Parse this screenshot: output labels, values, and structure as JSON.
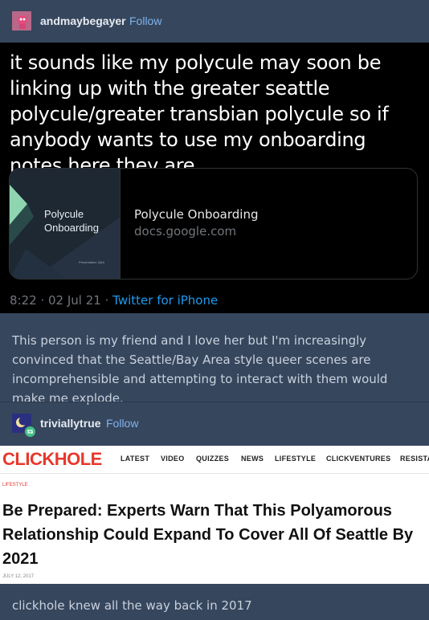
{
  "post1": {
    "username": "andmaybegayer",
    "follow_label": "Follow"
  },
  "tweet": {
    "text": "it sounds like my polycule may soon be linking up with the greater seattle polycule/greater transbian polycule so if anybody wants to use my onboarding notes here they are",
    "card": {
      "thumb_title": "Polycule\nOnboarding",
      "thumb_footer": "Presentation Q&A",
      "title": "Polycule Onboarding",
      "domain": "docs.google.com"
    },
    "time": "8:22",
    "date": "02 Jul 21",
    "source": "Twitter for iPhone"
  },
  "comment1": "This person is my friend and I love her but I'm increasingly convinced that the Seattle/Bay Area style queer scenes are incomprehensible and attempting to interact with them would make me explode.",
  "post2": {
    "username": "triviallytrue",
    "follow_label": "Follow"
  },
  "clickhole": {
    "logo": "CLICKHOLE",
    "nav": [
      "LATEST",
      "VIDEO",
      "QUIZZES",
      "NEWS",
      "LIFESTYLE",
      "CLICKVENTURES",
      "RESISTANCE"
    ],
    "section": "LIFESTYLE",
    "headline": "Be Prepared: Experts Warn That This Polyamorous Relationship Could Expand To Cover All Of Seattle By 2021",
    "date": "JULY 12, 2017"
  },
  "comment2": "clickhole knew all the way back in 2017",
  "colors": {
    "background": "#36465d",
    "follow": "#7fb4ee",
    "twitter_blue": "#1d9bf0",
    "clickhole_red": "#e8382c"
  },
  "icons": [
    "avatar-pink-creature",
    "avatar-moon",
    "reblog-icon"
  ]
}
